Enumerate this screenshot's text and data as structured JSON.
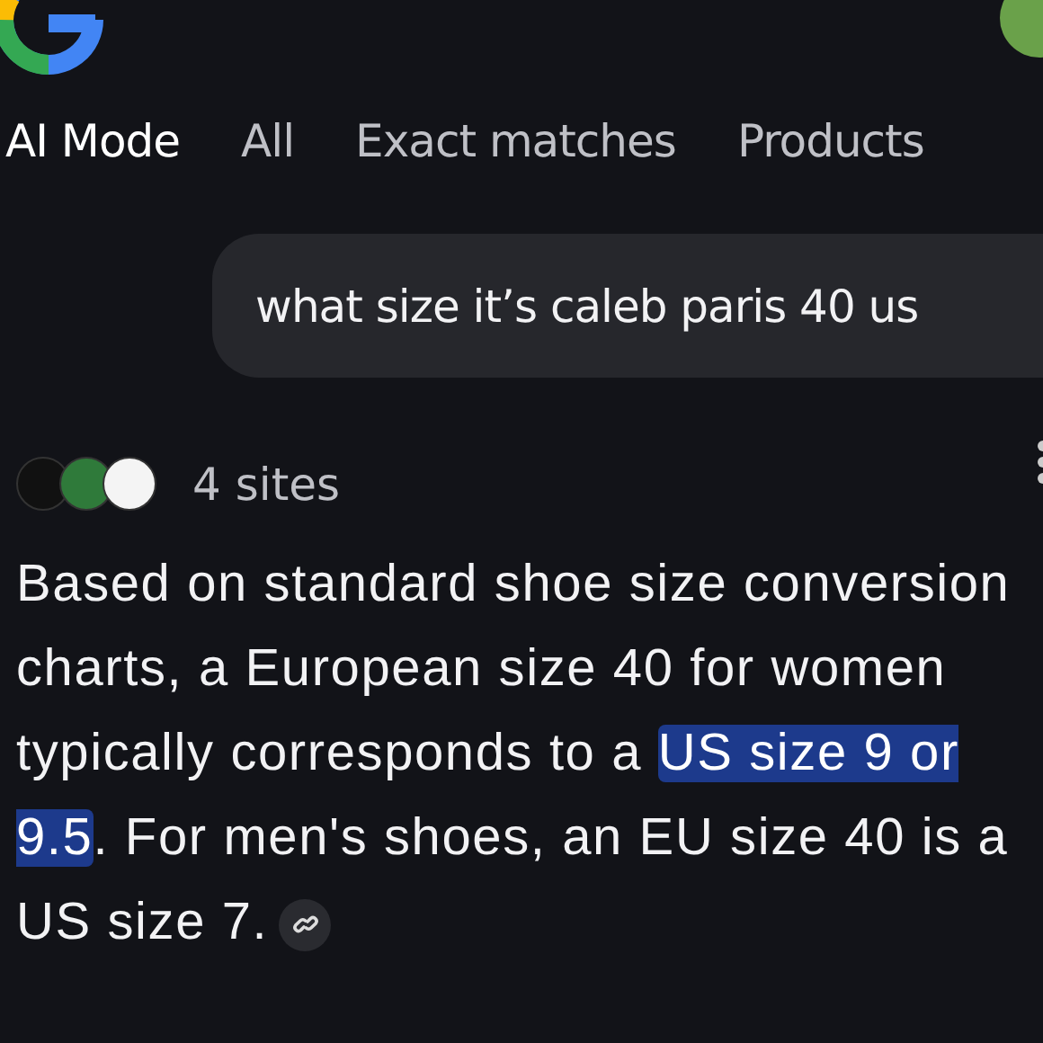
{
  "tabs": [
    {
      "label": "AI Mode",
      "selected": true
    },
    {
      "label": "All",
      "selected": false
    },
    {
      "label": "Exact matches",
      "selected": false
    },
    {
      "label": "Products",
      "selected": false
    }
  ],
  "query": "what size it’s caleb paris 40 us",
  "sources": {
    "count": "4 sites"
  },
  "answer": [
    {
      "text": "Based on standard shoe size conversion charts, a European size 40 for women typically corresponds to a ",
      "highlighted": false
    },
    {
      "text": "US size 9 or 9.5",
      "highlighted": true
    },
    {
      "text": ". For men's shoes, an EU size 40 is a US size 7.",
      "highlighted": false
    }
  ]
}
